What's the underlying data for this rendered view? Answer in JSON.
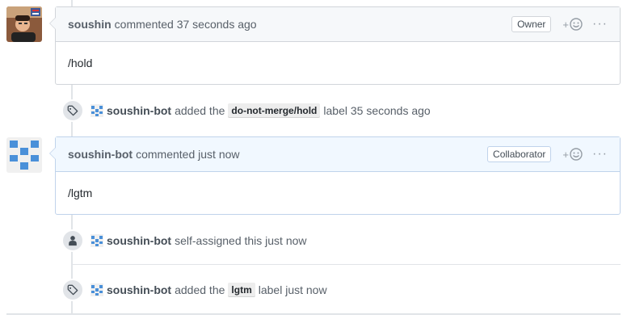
{
  "comments": [
    {
      "author": "soushin",
      "meta": "commented 37 seconds ago",
      "role": "Owner",
      "body": "/hold",
      "avatar_icon": "human-photo-avatar"
    },
    {
      "author": "soushin-bot",
      "meta": "commented just now",
      "role": "Collaborator",
      "body": "/lgtm",
      "avatar_icon": "identicon-avatar"
    }
  ],
  "events": [
    {
      "icon": "tag-icon",
      "actor": "soushin-bot",
      "text_before": "added the",
      "label": "do-not-merge/hold",
      "text_after": "label 35 seconds ago"
    },
    {
      "icon": "person-icon",
      "actor": "soushin-bot",
      "text_before": "self-assigned this just now"
    },
    {
      "icon": "tag-icon",
      "actor": "soushin-bot",
      "text_before": "added the",
      "label": "lgtm",
      "text_after": "label just now"
    }
  ],
  "actions": {
    "reaction_plus": "+",
    "more": "···"
  },
  "colors": {
    "identicon": "#4a90d9",
    "bot_header_bg": "#f1f8ff",
    "header_bg": "#f6f8fa"
  }
}
